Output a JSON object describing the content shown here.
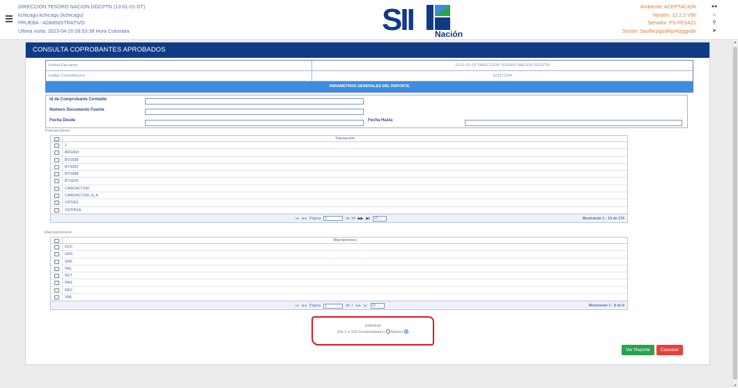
{
  "header": {
    "entity": "DIRECCION TESORO NACION DGCPTN (13-01-01-DT)",
    "user": "kchicagu kchicagu (kchicagu)",
    "profile": "PRUEBA - ADMINISTRATIVO",
    "last_visit": "Última visita: 2023-04-20 09:53:38 Hora Colombia",
    "environment": "Ambiente: ACEPTACION",
    "version": "Versión: 12.2.2 V90",
    "server": "Servidor: PS-FESA21",
    "session": "Sesión: 5aulfxcpguafvjs4tzjggxdn",
    "logo_text": "SIIF",
    "logo_sub": "Nación",
    "icons": [
      "users-icon",
      "bank-icon",
      "key-icon",
      "logout-icon"
    ]
  },
  "panel": {
    "title": "CONSULTA COPROBANTES APROBADOS",
    "unidad_label": "Unidad Ejecutora",
    "unidad_value": "13-01-01-DT DIRECCION TESORO NACION DGCPTN",
    "codigo_label": "Codigo Consolidacion",
    "codigo_value": "923272394",
    "params_header": "PARAMETROS GENERALES DEL REPORTE",
    "fields": {
      "id_label": "Id de Comprobante Contable",
      "doc_label": "Número Documento Fuente",
      "desde_label": "Fecha Desde",
      "hasta_label": "Fecha Hasta"
    }
  },
  "transacciones": {
    "section_label": "Transacciones:",
    "column": "Transacción",
    "rows": [
      "1",
      "ADG003",
      "BYS038",
      "BYS052",
      "BYS068",
      "BYS076",
      "CARGNCT230",
      "CARGNCT230_A_A",
      "CNT051",
      "CNT051A"
    ],
    "pager": {
      "page_label": "Página",
      "page_value": "1",
      "of_label": "de 18",
      "per_page": "10",
      "summary": "Mostrando 1 - 10 de 174"
    }
  },
  "macroprocesos": {
    "section_label": "Macroprocesos:",
    "column": "Macroproceso",
    "rows": [
      "DYC",
      "GAS",
      "GRF",
      "ING",
      "NCT",
      "PAG",
      "REC",
      "XML"
    ],
    "pager": {
      "page_label": "Página",
      "page_value": "1",
      "of_label": "de 1",
      "per_page": "10",
      "summary": "Mostrando 1 - 8 de 8"
    }
  },
  "options": {
    "individual_label": "Individual",
    "individual_range": "(De 1 a 100 Comprobantes)",
    "masivo_label": "Masivo",
    "selected": "Masivo"
  },
  "buttons": {
    "report": "Ver Reporte",
    "cancel": "Cancelar"
  },
  "colors": {
    "title_bar": "#103a84",
    "params_header": "#3d8de0",
    "annotation": "#e0121c",
    "report_btn": "#2aa34c",
    "cancel_btn": "#e8403a"
  }
}
